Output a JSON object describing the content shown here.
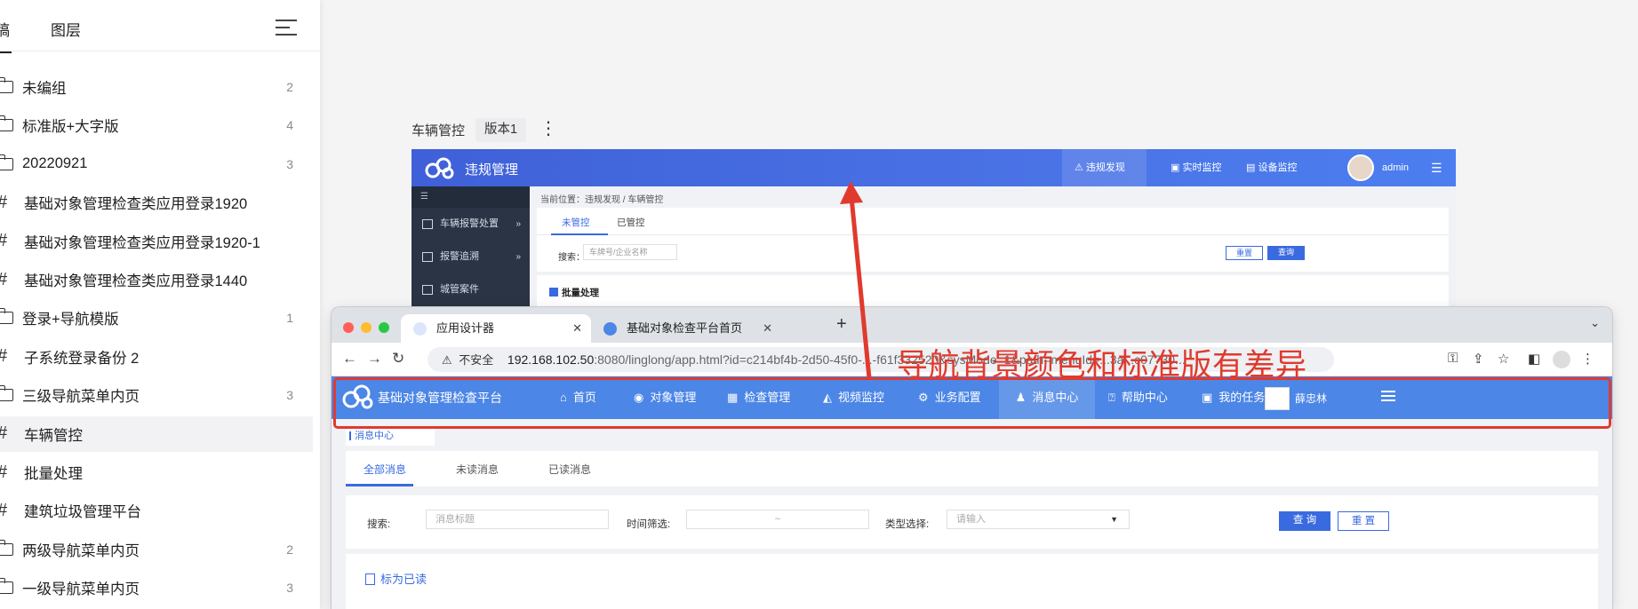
{
  "left_panel": {
    "tabs": [
      {
        "label": "稿"
      },
      {
        "label": "图层"
      }
    ],
    "items": [
      {
        "icon": "folder-icon",
        "label": "未编组",
        "count": "2"
      },
      {
        "icon": "folder-icon",
        "label": "标准版+大字版",
        "count": "4"
      },
      {
        "icon": "folder-open-icon",
        "label": "20220921",
        "count": "3"
      },
      {
        "icon": "frame-icon",
        "label": "基础对象管理检查类应用登录1920",
        "count": ""
      },
      {
        "icon": "frame-icon",
        "label": "基础对象管理检查类应用登录1920-1",
        "count": ""
      },
      {
        "icon": "frame-icon",
        "label": "基础对象管理检查类应用登录1440",
        "count": ""
      },
      {
        "icon": "folder-open-icon",
        "label": "登录+导航模版",
        "count": "1"
      },
      {
        "icon": "frame-icon",
        "label": "子系统登录备份 2",
        "count": ""
      },
      {
        "icon": "folder-open-icon",
        "label": "三级导航菜单内页",
        "count": "3"
      },
      {
        "icon": "frame-icon",
        "label": "车辆管控",
        "count": "",
        "selected": true
      },
      {
        "icon": "frame-icon",
        "label": "批量处理",
        "count": ""
      },
      {
        "icon": "frame-icon",
        "label": "建筑垃圾管理平台",
        "count": ""
      },
      {
        "icon": "folder-icon",
        "label": "两级导航菜单内页",
        "count": "2"
      },
      {
        "icon": "folder-icon",
        "label": "一级导航菜单内页",
        "count": "3"
      }
    ]
  },
  "frame": {
    "title": "车辆管控",
    "version": "版本1"
  },
  "mock1": {
    "title": "违规管理",
    "nav": [
      "违规发现",
      "实时监控",
      "设备监控"
    ],
    "user": "admin",
    "sidebar": [
      "车辆报警处置",
      "报警追溯",
      "城管案件"
    ],
    "breadcrumb": "当前位置：违规发现 / 车辆管控",
    "tabs": [
      "未管控",
      "已管控"
    ],
    "search_label": "搜索：",
    "search_placeholder": "车牌号/企业名称",
    "btn_reset": "重置",
    "btn_query": "查询",
    "batch": "批量处理"
  },
  "browser": {
    "tabs": [
      {
        "label": "应用设计器"
      },
      {
        "label": "基础对象检查平台首页"
      }
    ],
    "insecure": "不安全",
    "url_host": "192.168.102.50",
    "url_path": ":8080/linglong/app.html?id=c214bf4b-2d50-45f0-...-f61f332520&sysMode=1&path=menuId=...3a...c07730..."
  },
  "app": {
    "title": "基础对象管理检查平台",
    "nav": [
      {
        "label": "首页",
        "icon": "home-icon"
      },
      {
        "label": "对象管理",
        "icon": "object-icon"
      },
      {
        "label": "检查管理",
        "icon": "check-icon"
      },
      {
        "label": "视频监控",
        "icon": "camera-icon"
      },
      {
        "label": "业务配置",
        "icon": "gear-icon"
      },
      {
        "label": "消息中心",
        "icon": "bell-icon",
        "active": true
      },
      {
        "label": "帮助中心",
        "icon": "help-icon"
      },
      {
        "label": "我的任务",
        "icon": "task-icon"
      }
    ],
    "user": "薛忠林",
    "breadcrumb": "消息中心",
    "msg_tabs": [
      "全部消息",
      "未读消息",
      "已读消息"
    ],
    "search_label": "搜索:",
    "search_placeholder": "消息标题",
    "time_label": "时间筛选:",
    "time_sep": "~",
    "type_label": "类型选择:",
    "type_placeholder": "请输入",
    "btn_query": "查 询",
    "btn_reset": "重 置",
    "mark_read": "标为已读"
  },
  "annotation": "导航背景颜色和标准版有差异",
  "colors": {
    "annotation": "#e03a2e",
    "app_header": "#4c86e6",
    "mock_header": "#4468df",
    "accent": "#3a6ae0"
  }
}
